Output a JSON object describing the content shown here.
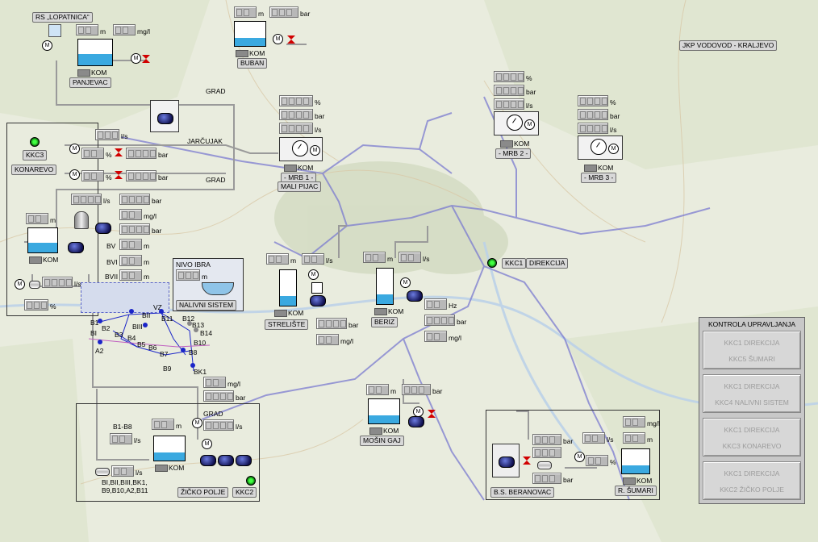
{
  "header": {
    "org": "JKP VODOVOD - KRALJEVO"
  },
  "units": {
    "m": "m",
    "bar": "bar",
    "ls": "l/s",
    "pct": "%",
    "mgl": "mg/l",
    "hz": "Hz"
  },
  "kom": "KOM",
  "motor_symbol": "M",
  "stations": {
    "rs": "RS „LOPATNICA“",
    "panjevac": "PANJEVAC",
    "buban": "BUBAN",
    "jarcujak": "JARČUJAK",
    "grad1": "GRAD",
    "grad2": "GRAD",
    "grad3": "GRAD",
    "mrb1_line1": "- MRB 1 -",
    "mrb1_line2": "MALI PIJAC",
    "mrb2": "- MRB 2 -",
    "mrb3": "- MRB 3 -",
    "kkc3": "KKC3",
    "konarevo": "KONAREVO",
    "kkc1": "KKC1",
    "direkcija": "DIREKCIJA",
    "strelishte": "STRELIŠTE",
    "beriz": "BERIZ",
    "nivo_ibra": "NIVO IBRA",
    "nalivni_sistem": "NALIVNI SISTEM",
    "mosin_gaj": "MOŠIN GAJ",
    "zicko_polje": "ŽIČKO POLJE",
    "kkc2": "KKC2",
    "bs_beranovac": "B.S. BERANOVAC",
    "r_sumari": "R. ŠUMARI",
    "b1_b8": "B1-B8",
    "bk1": "BK1",
    "wells_line1": "BI,BII,BIII,BK1,",
    "wells_line2": "B9,B10,A2,B11",
    "bv": "BV",
    "bvi": "BVI",
    "bvii": "BVII",
    "dash": "-",
    "wells": [
      "BI",
      "BII",
      "BIII",
      "B1",
      "B2",
      "B3",
      "B4",
      "B5",
      "B6",
      "B7",
      "B8",
      "B9",
      "B10",
      "B11",
      "B12",
      "B13",
      "B14",
      "A2",
      "VZ"
    ]
  },
  "control": {
    "title": "KONTROLA UPRAVLJANJA",
    "buttons": [
      {
        "line1": "KKC1 DIREKCIJA",
        "line2": "KKC5 ŠUMARI"
      },
      {
        "line1": "KKC1 DIREKCIJA",
        "line2": "KKC4 NALIVNI SISTEM"
      },
      {
        "line1": "KKC1 DIREKCIJA",
        "line2": "KKC3 KONAREVO"
      },
      {
        "line1": "KKC1 DIREKCIJA",
        "line2": "KKC2 ŽIČKO POLJE"
      }
    ]
  },
  "colors": {
    "water": "#3aa9e0",
    "pipe": "#a0a0a0",
    "valve": "#d10000",
    "pump": "#101050",
    "map_road": "#7b7bd0"
  }
}
